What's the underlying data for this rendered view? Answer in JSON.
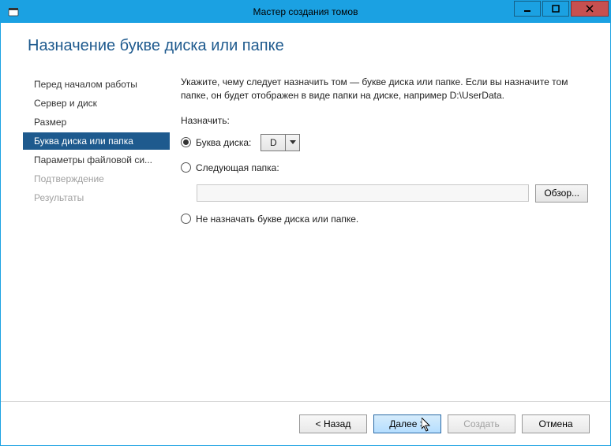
{
  "window": {
    "title": "Мастер создания томов"
  },
  "page": {
    "title": "Назначение букве диска или папке"
  },
  "sidebar": {
    "items": [
      {
        "label": "Перед началом работы",
        "state": "normal"
      },
      {
        "label": "Сервер и диск",
        "state": "normal"
      },
      {
        "label": "Размер",
        "state": "normal"
      },
      {
        "label": "Буква диска или папка",
        "state": "active"
      },
      {
        "label": "Параметры файловой си...",
        "state": "normal"
      },
      {
        "label": "Подтверждение",
        "state": "disabled"
      },
      {
        "label": "Результаты",
        "state": "disabled"
      }
    ]
  },
  "main": {
    "instruction": "Укажите, чему следует назначить том — букве диска или папке. Если вы назначите том папке, он будет отображен в виде папки на диске, например D:\\UserData.",
    "assign_label": "Назначить:",
    "option_drive_label": "Буква диска:",
    "drive_value": "D",
    "option_folder_label": "Следующая папка:",
    "folder_path": "",
    "browse_label": "Обзор...",
    "option_none_label": "Не назначать букве диска или папке."
  },
  "footer": {
    "back": "< Назад",
    "next": "Далее >",
    "create": "Создать",
    "cancel": "Отмена"
  }
}
